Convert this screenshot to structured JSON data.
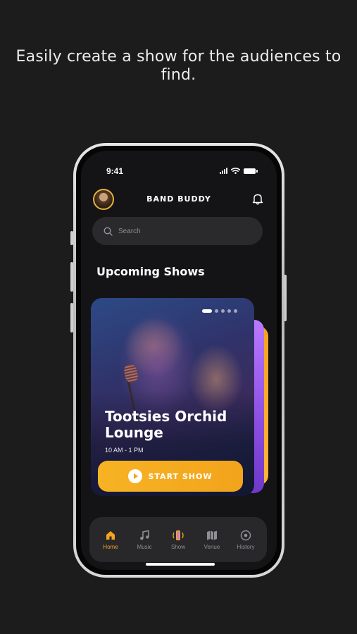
{
  "headline": "Easily create a show for the audiences to find.",
  "status_bar": {
    "time": "9:41"
  },
  "header": {
    "app_title": "BAND BUDDY"
  },
  "search": {
    "placeholder": "Search"
  },
  "section": {
    "title": "Upcoming Shows"
  },
  "show_card": {
    "venue": "Tootsies Orchid Lounge",
    "time": "10 AM - 1 PM",
    "button_label": "START SHOW",
    "carousel": {
      "count": 5,
      "active_index": 0
    }
  },
  "tabbar": {
    "items": [
      {
        "label": "Home",
        "icon": "home-icon",
        "active": true
      },
      {
        "label": "Music",
        "icon": "music-note-icon",
        "active": false
      },
      {
        "label": "Show",
        "icon": "show-icon",
        "active": false
      },
      {
        "label": "Venue",
        "icon": "venue-map-icon",
        "active": false
      },
      {
        "label": "History",
        "icon": "history-icon",
        "active": false
      }
    ]
  },
  "colors": {
    "background": "#1c1c1c",
    "accent": "#f2a41c",
    "screen": "#141416",
    "surface": "#28282b"
  }
}
